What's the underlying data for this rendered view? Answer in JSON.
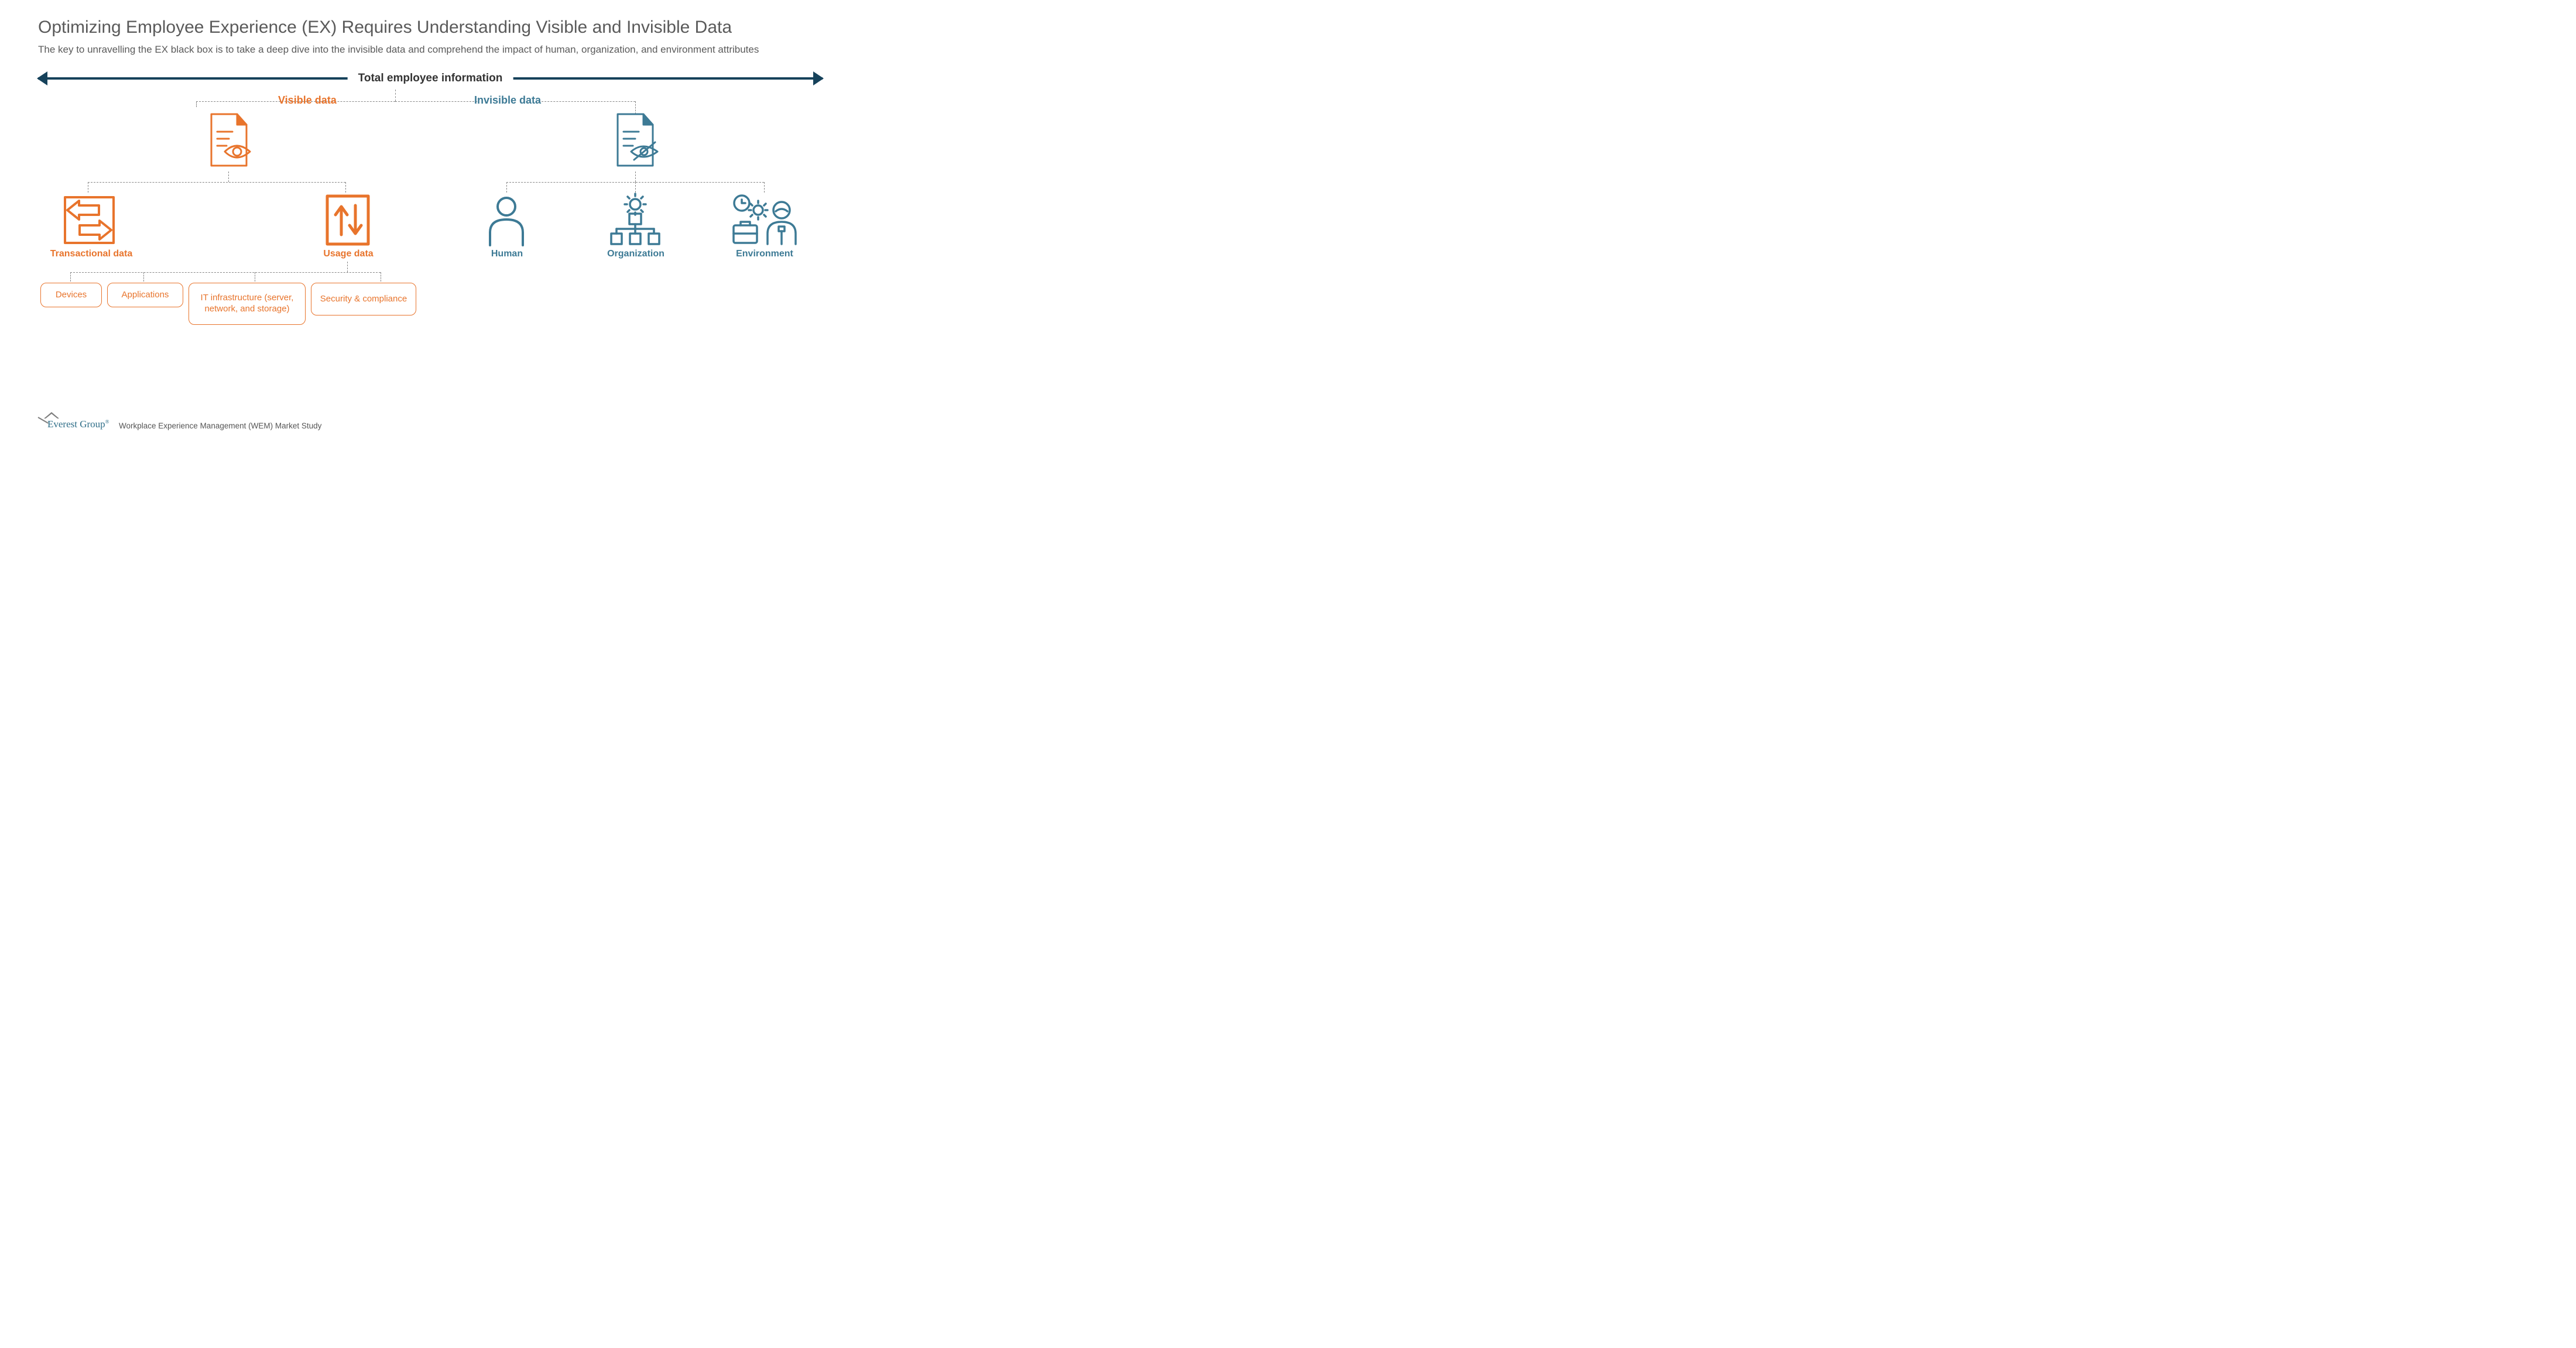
{
  "title": "Optimizing Employee Experience (EX) Requires Understanding Visible and Invisible Data",
  "subtitle": "The key to unravelling the EX black box is to take a deep dive into the invisible data and comprehend the impact of human, organization, and environment attributes",
  "axis_label": "Total employee information",
  "sections": {
    "visible": {
      "label": "Visible data"
    },
    "invisible": {
      "label": "Invisible data"
    }
  },
  "visible_children": {
    "transactional": {
      "label": "Transactional data"
    },
    "usage": {
      "label": "Usage data"
    }
  },
  "usage_children": {
    "devices": "Devices",
    "applications": "Applications",
    "it_infra": "IT infrastructure (server, network, and storage)",
    "security": "Security & compliance"
  },
  "invisible_children": {
    "human": "Human",
    "organization": "Organization",
    "environment": "Environment"
  },
  "footer": {
    "brand": "Everest Group",
    "reg": "®",
    "note": "Workplace Experience Management (WEM) Market Study"
  },
  "colors": {
    "orange": "#e8742c",
    "teal": "#3d7a95",
    "axis": "#16425b",
    "dash": "#888888"
  }
}
